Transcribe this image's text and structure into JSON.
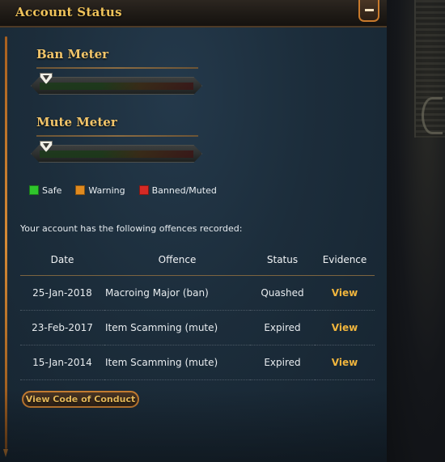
{
  "panel": {
    "title": "Account Status"
  },
  "meters": [
    {
      "title": "Ban Meter",
      "level": 0
    },
    {
      "title": "Mute Meter",
      "level": 0
    }
  ],
  "legend": [
    {
      "label": "Safe",
      "color": "#2fc52c"
    },
    {
      "label": "Warning",
      "color": "#e08a1f"
    },
    {
      "label": "Banned/Muted",
      "color": "#d52a25"
    }
  ],
  "offences": {
    "intro": "Your account has the following offences recorded:",
    "columns": [
      "Date",
      "Offence",
      "Status",
      "Evidence"
    ],
    "rows": [
      {
        "date": "25-Jan-2018",
        "offence": "Macroing Major (ban)",
        "status": "Quashed",
        "evidence": "View"
      },
      {
        "date": "23-Feb-2017",
        "offence": "Item Scamming (mute)",
        "status": "Expired",
        "evidence": "View"
      },
      {
        "date": "15-Jan-2014",
        "offence": "Item Scamming (mute)",
        "status": "Expired",
        "evidence": "View"
      }
    ]
  },
  "conduct_button": "View Code of Conduct",
  "colors": {
    "accent_gold": "#f0b53d",
    "panel_blue": "#1c2d3b",
    "frame_orange": "#c67d31"
  }
}
